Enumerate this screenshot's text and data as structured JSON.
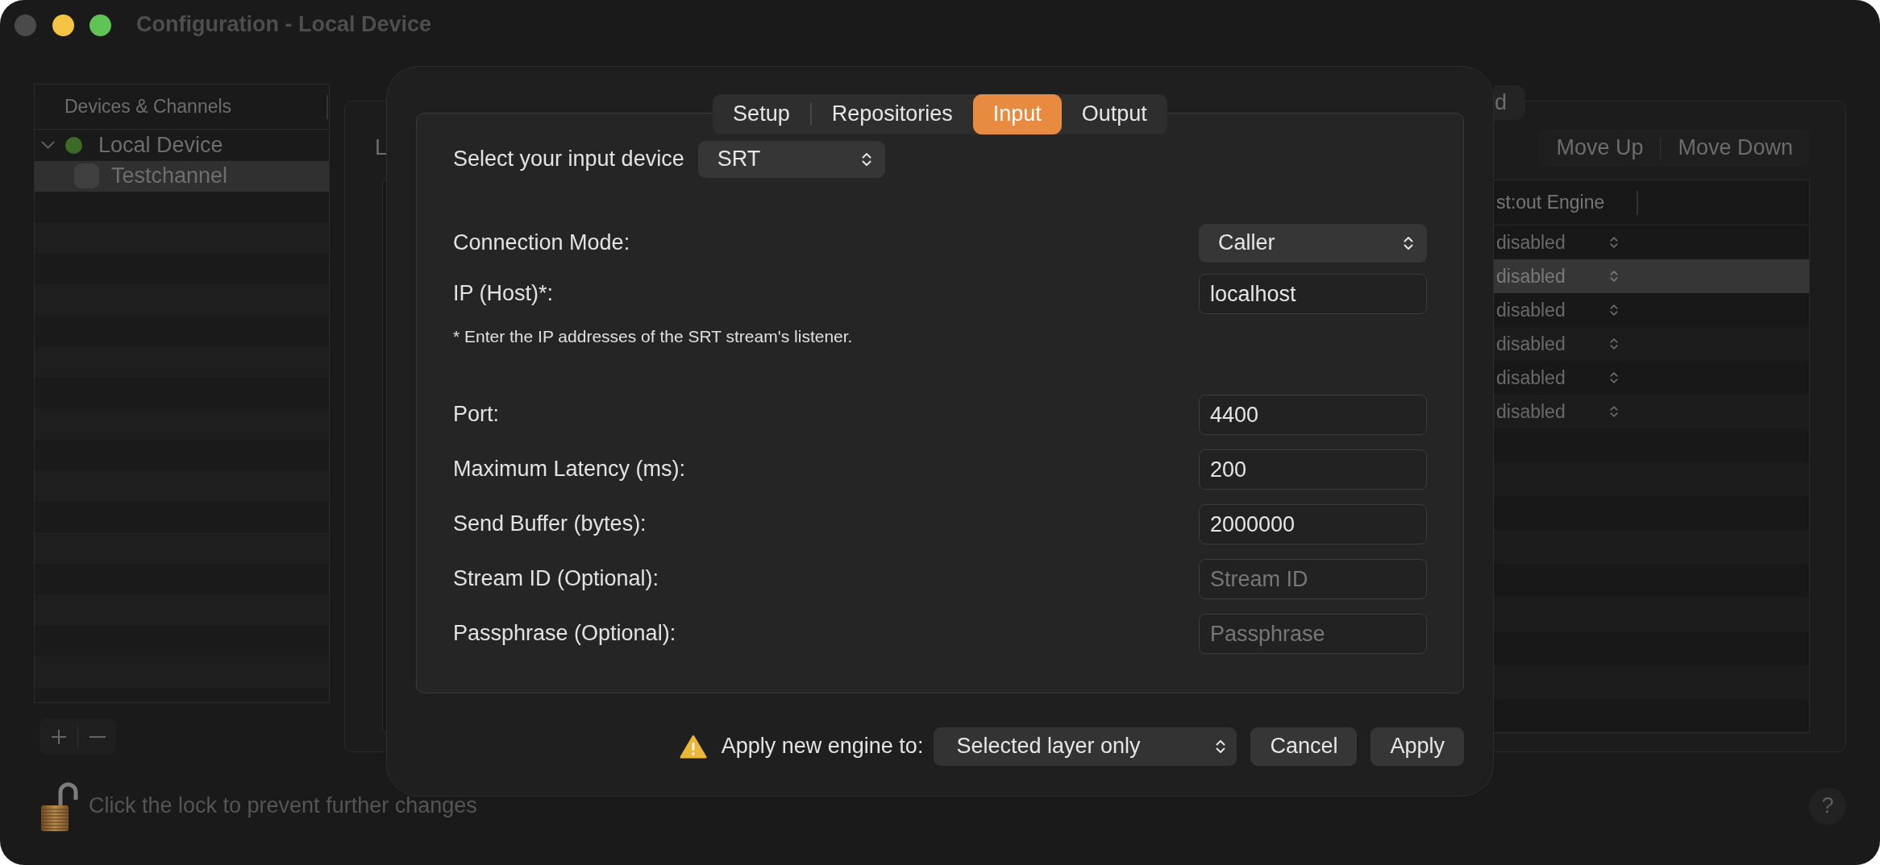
{
  "window": {
    "title": "Configuration - Local Device",
    "controls": [
      {
        "kind": "close",
        "enabled": false
      },
      {
        "kind": "minimize",
        "enabled": true
      },
      {
        "kind": "zoom",
        "enabled": true
      }
    ]
  },
  "sidebar": {
    "header": "Devices & Channels",
    "items": [
      {
        "kind": "device",
        "label": "Local Device",
        "color": "#3e6a27",
        "expanded": true,
        "selected": false,
        "children": [
          {
            "kind": "channel",
            "label": "Testchannel",
            "selected": true
          }
        ]
      }
    ]
  },
  "content": {
    "tab_fragment": "d",
    "label_fragment": "L",
    "order_buttons": [
      "Move Up",
      "Move Down"
    ],
    "table": {
      "columns": [
        "st:out Engine"
      ],
      "rows": [
        {
          "engine": "disabled",
          "selected": false
        },
        {
          "engine": "disabled",
          "selected": true
        },
        {
          "engine": "disabled",
          "selected": false
        },
        {
          "engine": "disabled",
          "selected": false
        },
        {
          "engine": "disabled",
          "selected": false
        },
        {
          "engine": "disabled",
          "selected": false
        }
      ]
    }
  },
  "dialog": {
    "tabs": [
      {
        "label": "Setup",
        "selected": false
      },
      {
        "label": "Repositories",
        "selected": false
      },
      {
        "label": "Input",
        "selected": true
      },
      {
        "label": "Output",
        "selected": false
      }
    ],
    "device_select": {
      "label": "Select your input device",
      "value": "SRT"
    },
    "fields": [
      {
        "kind": "select",
        "label": "Connection Mode:",
        "value": "Caller"
      },
      {
        "kind": "text",
        "label": "IP (Host)*:",
        "value": "localhost"
      },
      {
        "kind": "note",
        "text": "* Enter the IP addresses of the SRT stream's listener."
      },
      {
        "kind": "text",
        "label": "Port:",
        "value": "4400"
      },
      {
        "kind": "text",
        "label": "Maximum Latency (ms):",
        "value": "200"
      },
      {
        "kind": "text",
        "label": "Send Buffer (bytes):",
        "value": "2000000"
      },
      {
        "kind": "text",
        "label": "Stream ID (Optional):",
        "placeholder": "Stream ID"
      },
      {
        "kind": "text",
        "label": "Passphrase (Optional):",
        "placeholder": "Passphrase"
      }
    ],
    "footer": {
      "label": "Apply new engine to:",
      "scope": "Selected layer only",
      "buttons": [
        "Cancel",
        "Apply"
      ]
    }
  },
  "lock": {
    "text": "Click the lock to prevent further changes",
    "locked": false
  },
  "help_button": "?"
}
